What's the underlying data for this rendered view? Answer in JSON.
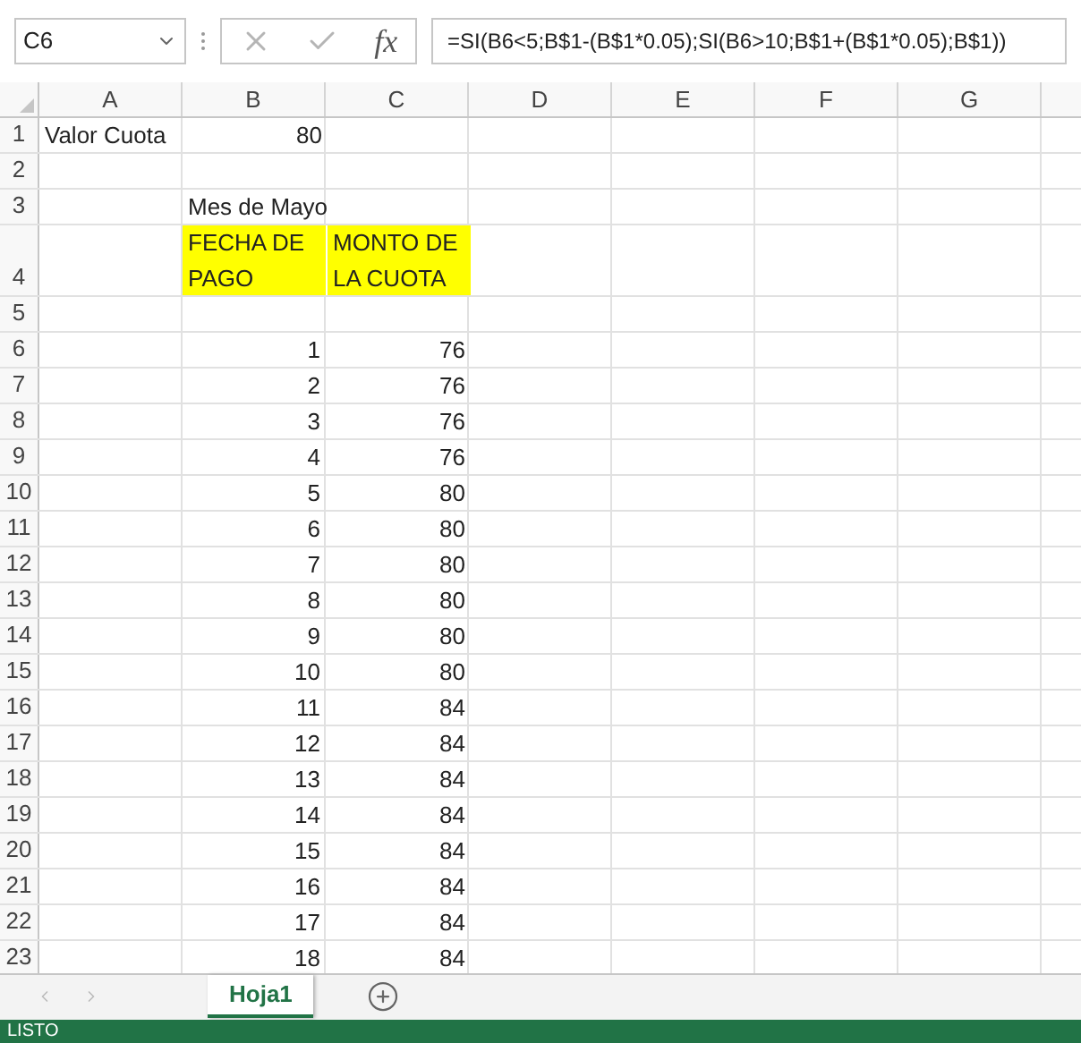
{
  "formula_bar": {
    "name_box": "C6",
    "function_label": "fx",
    "formula": "=SI(B6<5;B$1-(B$1*0.05);SI(B6>10;B$1+(B$1*0.05);B$1))"
  },
  "columns": [
    "A",
    "B",
    "C",
    "D",
    "E",
    "F",
    "G"
  ],
  "rows": [
    {
      "number": "1",
      "cells": [
        {
          "value": "Valor Cuota",
          "kind": "text",
          "highlighted": false
        },
        {
          "value": "80",
          "kind": "number",
          "highlighted": false
        }
      ]
    },
    {
      "number": "2",
      "cells": []
    },
    {
      "number": "3",
      "cells": [
        null,
        {
          "value": "Mes de Mayo",
          "kind": "text",
          "highlighted": false
        }
      ]
    },
    {
      "number": "4",
      "tall": true,
      "cells": [
        null,
        {
          "value": "FECHA DE PAGO",
          "kind": "text",
          "highlighted": true
        },
        {
          "value": "MONTO DE LA CUOTA",
          "kind": "text",
          "highlighted": true
        }
      ]
    },
    {
      "number": "5",
      "cells": []
    },
    {
      "number": "6",
      "cells": [
        null,
        {
          "value": "1",
          "kind": "number",
          "highlighted": false
        },
        {
          "value": "76",
          "kind": "number",
          "highlighted": false
        }
      ]
    },
    {
      "number": "7",
      "cells": [
        null,
        {
          "value": "2",
          "kind": "number",
          "highlighted": false
        },
        {
          "value": "76",
          "kind": "number",
          "highlighted": false
        }
      ]
    },
    {
      "number": "8",
      "cells": [
        null,
        {
          "value": "3",
          "kind": "number",
          "highlighted": false
        },
        {
          "value": "76",
          "kind": "number",
          "highlighted": false
        }
      ]
    },
    {
      "number": "9",
      "cells": [
        null,
        {
          "value": "4",
          "kind": "number",
          "highlighted": false
        },
        {
          "value": "76",
          "kind": "number",
          "highlighted": false
        }
      ]
    },
    {
      "number": "10",
      "cells": [
        null,
        {
          "value": "5",
          "kind": "number",
          "highlighted": false
        },
        {
          "value": "80",
          "kind": "number",
          "highlighted": false
        }
      ]
    },
    {
      "number": "11",
      "cells": [
        null,
        {
          "value": "6",
          "kind": "number",
          "highlighted": false
        },
        {
          "value": "80",
          "kind": "number",
          "highlighted": false
        }
      ]
    },
    {
      "number": "12",
      "cells": [
        null,
        {
          "value": "7",
          "kind": "number",
          "highlighted": false
        },
        {
          "value": "80",
          "kind": "number",
          "highlighted": false
        }
      ]
    },
    {
      "number": "13",
      "cells": [
        null,
        {
          "value": "8",
          "kind": "number",
          "highlighted": false
        },
        {
          "value": "80",
          "kind": "number",
          "highlighted": false
        }
      ]
    },
    {
      "number": "14",
      "cells": [
        null,
        {
          "value": "9",
          "kind": "number",
          "highlighted": false
        },
        {
          "value": "80",
          "kind": "number",
          "highlighted": false
        }
      ]
    },
    {
      "number": "15",
      "cells": [
        null,
        {
          "value": "10",
          "kind": "number",
          "highlighted": false
        },
        {
          "value": "80",
          "kind": "number",
          "highlighted": false
        }
      ]
    },
    {
      "number": "16",
      "cells": [
        null,
        {
          "value": "11",
          "kind": "number",
          "highlighted": false
        },
        {
          "value": "84",
          "kind": "number",
          "highlighted": false
        }
      ]
    },
    {
      "number": "17",
      "cells": [
        null,
        {
          "value": "12",
          "kind": "number",
          "highlighted": false
        },
        {
          "value": "84",
          "kind": "number",
          "highlighted": false
        }
      ]
    },
    {
      "number": "18",
      "cells": [
        null,
        {
          "value": "13",
          "kind": "number",
          "highlighted": false
        },
        {
          "value": "84",
          "kind": "number",
          "highlighted": false
        }
      ]
    },
    {
      "number": "19",
      "cells": [
        null,
        {
          "value": "14",
          "kind": "number",
          "highlighted": false
        },
        {
          "value": "84",
          "kind": "number",
          "highlighted": false
        }
      ]
    },
    {
      "number": "20",
      "cells": [
        null,
        {
          "value": "15",
          "kind": "number",
          "highlighted": false
        },
        {
          "value": "84",
          "kind": "number",
          "highlighted": false
        }
      ]
    },
    {
      "number": "21",
      "cells": [
        null,
        {
          "value": "16",
          "kind": "number",
          "highlighted": false
        },
        {
          "value": "84",
          "kind": "number",
          "highlighted": false
        }
      ]
    },
    {
      "number": "22",
      "cells": [
        null,
        {
          "value": "17",
          "kind": "number",
          "highlighted": false
        },
        {
          "value": "84",
          "kind": "number",
          "highlighted": false
        }
      ]
    },
    {
      "number": "23",
      "cells": [
        null,
        {
          "value": "18",
          "kind": "number",
          "highlighted": false
        },
        {
          "value": "84",
          "kind": "number",
          "highlighted": false
        }
      ]
    }
  ],
  "sheet_tabs": [
    {
      "label": "Hoja1",
      "selected": true
    }
  ],
  "status_bar": {
    "text": "LISTO"
  }
}
